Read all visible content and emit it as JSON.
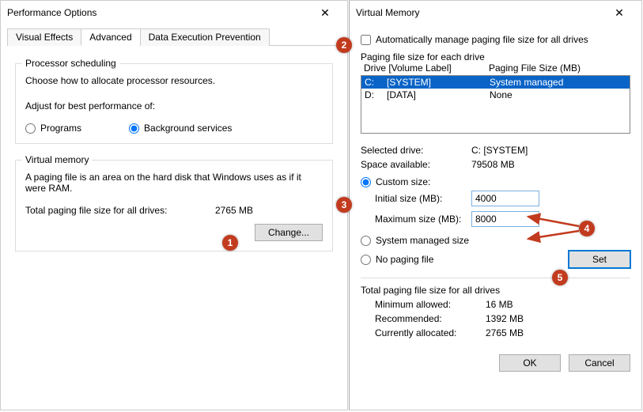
{
  "left": {
    "title": "Performance Options",
    "tabs": [
      "Visual Effects",
      "Advanced",
      "Data Execution Prevention"
    ],
    "active_tab": 1,
    "sched": {
      "group": "Processor scheduling",
      "desc": "Choose how to allocate processor resources.",
      "adjust": "Adjust for best performance of:",
      "opt_programs": "Programs",
      "opt_bg": "Background services"
    },
    "vm": {
      "group": "Virtual memory",
      "desc": "A paging file is an area on the hard disk that Windows uses as if it were RAM.",
      "total_label": "Total paging file size for all drives:",
      "total_value": "2765 MB",
      "change": "Change..."
    }
  },
  "right": {
    "title": "Virtual Memory",
    "auto": "Automatically manage paging file size for all drives",
    "list_group": "Paging file size for each drive",
    "head_drive": "Drive  [Volume Label]",
    "head_size": "Paging File Size (MB)",
    "drives": [
      {
        "letter": "C:",
        "label": "[SYSTEM]",
        "size": "System managed"
      },
      {
        "letter": "D:",
        "label": "[DATA]",
        "size": "None"
      }
    ],
    "selected_drive_label": "Selected drive:",
    "selected_drive_value": "C:   [SYSTEM]",
    "space_label": "Space available:",
    "space_value": "79508 MB",
    "custom": "Custom size:",
    "initial_label": "Initial size (MB):",
    "initial_value": "4000",
    "max_label": "Maximum size (MB):",
    "max_value": "8000",
    "sys_managed": "System managed size",
    "no_paging": "No paging file",
    "set": "Set",
    "totals_group": "Total paging file size for all drives",
    "min_label": "Minimum allowed:",
    "min_value": "16 MB",
    "rec_label": "Recommended:",
    "rec_value": "1392 MB",
    "cur_label": "Currently allocated:",
    "cur_value": "2765 MB",
    "ok": "OK",
    "cancel": "Cancel"
  },
  "notes": [
    "1",
    "2",
    "3",
    "4",
    "5"
  ]
}
